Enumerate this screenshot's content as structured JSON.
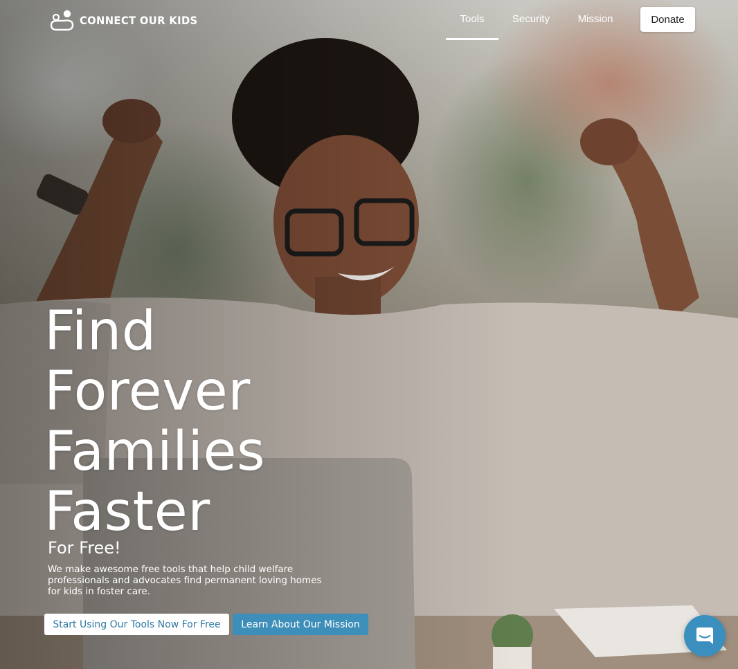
{
  "brand": {
    "name": "CONNECT OUR KIDS",
    "logo_icon": "family-icon"
  },
  "nav": {
    "items": [
      {
        "label": "Tools",
        "active": true
      },
      {
        "label": "Security",
        "active": false
      },
      {
        "label": "Mission",
        "active": false
      }
    ],
    "donate_label": "Donate"
  },
  "hero": {
    "headline_lines": [
      "Find",
      "Forever",
      "Families",
      "Faster"
    ],
    "subheading": "For Free!",
    "description": "We make awesome free tools that help child welfare professionals and advocates find permanent loving homes for kids in foster care.",
    "primary_cta": "Start Using Our Tools Now For Free",
    "secondary_cta": "Learn About Our Mission",
    "image": "woman-celebrating-at-laptop-photo"
  },
  "chat": {
    "icon": "chat-bubble-icon"
  },
  "colors": {
    "accent": "#3d8eb9",
    "primary_cta_text": "#2d7aa3",
    "chat_button": "#3a8fbf"
  }
}
